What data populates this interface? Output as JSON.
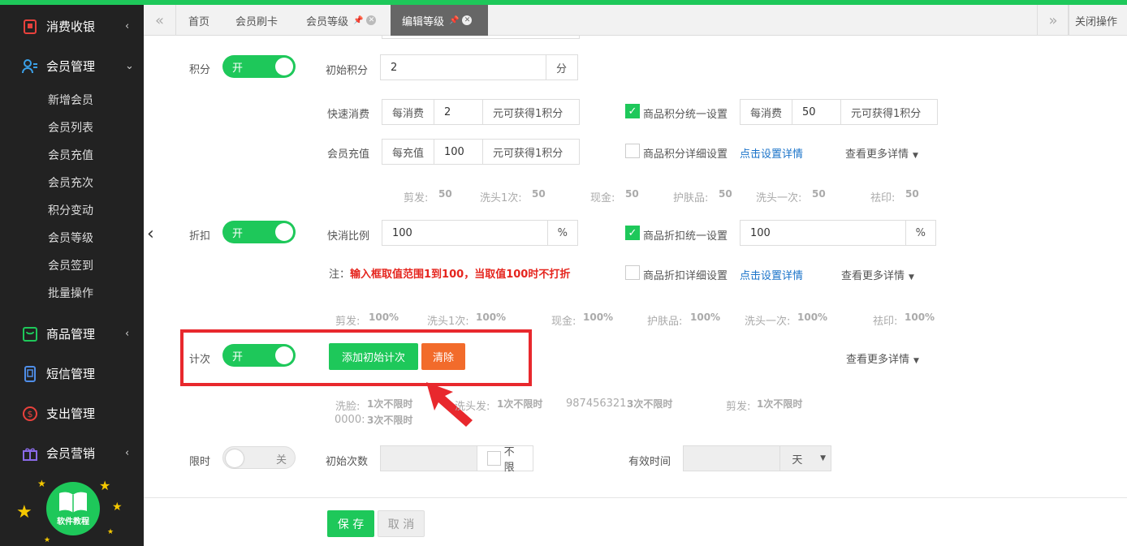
{
  "sidebar": {
    "menus": [
      {
        "label": "消费收银",
        "icon": "cashier-icon",
        "arrow": "‹"
      },
      {
        "label": "会员管理",
        "icon": "member-icon",
        "arrow": "⌄"
      },
      {
        "label": "商品管理",
        "icon": "goods-icon",
        "arrow": "‹"
      },
      {
        "label": "短信管理",
        "icon": "sms-icon",
        "arrow": ""
      },
      {
        "label": "支出管理",
        "icon": "expense-icon",
        "arrow": ""
      },
      {
        "label": "会员营销",
        "icon": "gift-icon",
        "arrow": "‹"
      }
    ],
    "submenu": [
      "新增会员",
      "会员列表",
      "会员充值",
      "会员充次",
      "积分变动",
      "会员等级",
      "会员签到",
      "批量操作"
    ],
    "badge_text": "软件教程"
  },
  "tabs": {
    "items": [
      {
        "label": "首页"
      },
      {
        "label": "会员刷卡"
      },
      {
        "label": "会员等级"
      },
      {
        "label": "编辑等级"
      }
    ],
    "close_ops": "关闭操作"
  },
  "points": {
    "label": "积分",
    "toggle": "开",
    "initial_label": "初始积分",
    "initial_value": "2",
    "initial_unit": "分",
    "quick_label": "快速消费",
    "quick_prefix": "每消费",
    "quick_value": "2",
    "quick_suffix": "元可获得1积分",
    "recharge_label": "会员充值",
    "recharge_prefix": "每充值",
    "recharge_value": "100",
    "recharge_suffix": "元可获得1积分",
    "uniform_label": "商品积分统一设置",
    "uniform_prefix": "每消费",
    "uniform_value": "50",
    "uniform_suffix": "元可获得1积分",
    "detail_label": "商品积分详细设置",
    "detail_link": "点击设置详情",
    "more": "查看更多详情",
    "stats": [
      {
        "k": "剪发:",
        "v": "50"
      },
      {
        "k": "洗头1次:",
        "v": "50"
      },
      {
        "k": "现金:",
        "v": "50"
      },
      {
        "k": "护肤品:",
        "v": "50"
      },
      {
        "k": "洗头一次:",
        "v": "50"
      },
      {
        "k": "祛印:",
        "v": "50"
      }
    ]
  },
  "discount": {
    "label": "折扣",
    "toggle": "开",
    "ratio_label": "快消比例",
    "ratio_value": "100",
    "ratio_unit": "%",
    "uniform_label": "商品折扣统一设置",
    "uniform_value": "100",
    "uniform_unit": "%",
    "note_prefix": "注：",
    "note_text": "输入框取值范围1到100，当取值100时不打折",
    "detail_label": "商品折扣详细设置",
    "detail_link": "点击设置详情",
    "more": "查看更多详情",
    "stats": [
      {
        "k": "剪发:",
        "v": "100%"
      },
      {
        "k": "洗头1次:",
        "v": "100%"
      },
      {
        "k": "现金:",
        "v": "100%"
      },
      {
        "k": "护肤品:",
        "v": "100%"
      },
      {
        "k": "洗头一次:",
        "v": "100%"
      },
      {
        "k": "祛印:",
        "v": "100%"
      }
    ]
  },
  "count": {
    "label": "计次",
    "toggle": "开",
    "add_button": "添加初始计次",
    "clear_button": "清除",
    "more": "查看更多详情",
    "stats": [
      {
        "k": "洗脸:",
        "v": "1次不限时"
      },
      {
        "k": "洗头发:",
        "v": "1次不限时"
      },
      {
        "k": "987456321:",
        "v": "3次不限时"
      },
      {
        "k": "剪发:",
        "v": "1次不限时"
      },
      {
        "k": "0000:",
        "v": "3次不限时"
      }
    ]
  },
  "timelimit": {
    "label": "限时",
    "toggle": "关",
    "initial_label": "初始次数",
    "unlimited_label": "不限",
    "valid_label": "有效时间",
    "unit_value": "天"
  },
  "footer": {
    "save": "保 存",
    "cancel": "取 消"
  },
  "colors": {
    "accent": "#1ec85a",
    "danger": "#f26b2b",
    "highlight": "#e8282d",
    "sidebar": "#222222"
  }
}
